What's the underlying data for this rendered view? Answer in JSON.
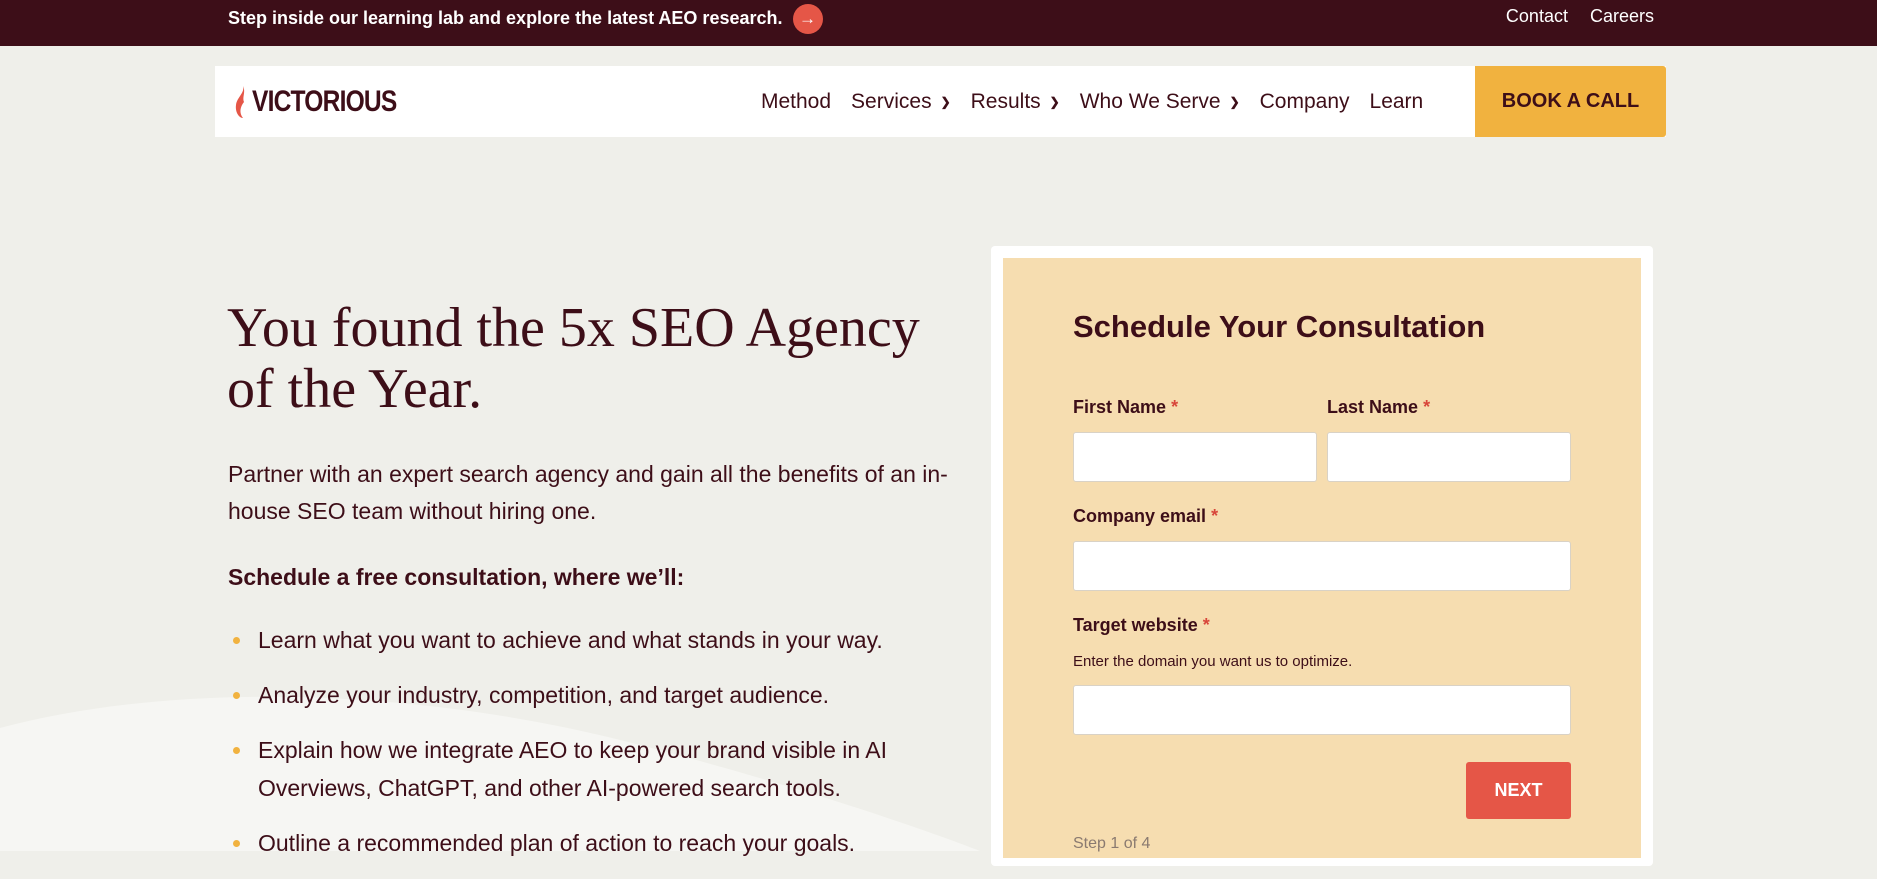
{
  "announcement": {
    "text": "Step inside our learning lab and explore the latest AEO research.",
    "arrow_icon": "arrow-right-icon"
  },
  "top_links": [
    "Contact",
    "Careers"
  ],
  "brand": {
    "name": "VICTORIOUS"
  },
  "nav": {
    "items": [
      {
        "label": "Method",
        "has_dropdown": false
      },
      {
        "label": "Services",
        "has_dropdown": true
      },
      {
        "label": "Results",
        "has_dropdown": true
      },
      {
        "label": "Who We Serve",
        "has_dropdown": true
      },
      {
        "label": "Company",
        "has_dropdown": false
      },
      {
        "label": "Learn",
        "has_dropdown": false
      }
    ],
    "cta": "BOOK A CALL"
  },
  "hero": {
    "title": "You found the 5x SEO Agency of the Year.",
    "subtitle": "Partner with an expert search agency and gain all the benefits of an in-house SEO team without hiring one.",
    "lead": "Schedule a free consultation, where we’ll:",
    "bullets": [
      "Learn what you want to achieve and what stands in your way.",
      "Analyze your industry, competition, and target audience.",
      "Explain how we integrate AEO to keep your brand visible in AI Overviews, ChatGPT, and other AI-powered search tools.",
      "Outline a recommended plan of action to reach your goals."
    ]
  },
  "form": {
    "title": "Schedule Your Consultation",
    "first_name_label": "First Name",
    "last_name_label": "Last Name",
    "email_label": "Company email",
    "website_label": "Target website",
    "website_help": "Enter the domain you want us to optimize.",
    "required_mark": "*",
    "next_label": "NEXT",
    "step_text": "Step 1 of 4"
  },
  "colors": {
    "dark_maroon": "#3d0e18",
    "accent_red": "#e55647",
    "accent_gold": "#f1b23f",
    "form_bg": "#f6ddb0",
    "page_bg": "#efefea"
  }
}
